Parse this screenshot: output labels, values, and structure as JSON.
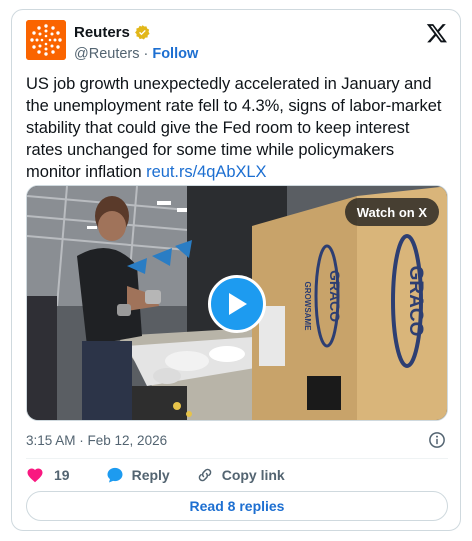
{
  "account": {
    "display_name": "Reuters",
    "handle": "@Reuters",
    "separator": "·",
    "follow_label": "Follow",
    "avatar_icon": "reuters-logo",
    "avatar_color": "#fa6400",
    "verified_icon": "gold-verified-badge"
  },
  "tweet": {
    "text": "US job growth unexpectedly accelerated in January and the unemployment rate fell to 4.3%, signs of labor-market stability that could give the Fed room to keep interest rates unchanged for some time while policymakers monitor inflation ",
    "link": "reut.rs/4qAbXLX"
  },
  "media": {
    "watch_label": "Watch on X",
    "play_icon": "play-icon",
    "box_brand": "GRACO",
    "box_subbrand": "GROWSAME"
  },
  "meta": {
    "timestamp": "3:15 AM · Feb 12, 2026",
    "info_icon": "info-icon"
  },
  "actions": {
    "like_count": "19",
    "reply_label": "Reply",
    "copy_label": "Copy link",
    "like_color": "#f91880",
    "reply_color": "#1d9bf0"
  },
  "replies": {
    "label": "Read 8 replies"
  },
  "colors": {
    "link": "#1d6fd1",
    "secondary_text": "#536471",
    "border": "#cfd9de"
  }
}
